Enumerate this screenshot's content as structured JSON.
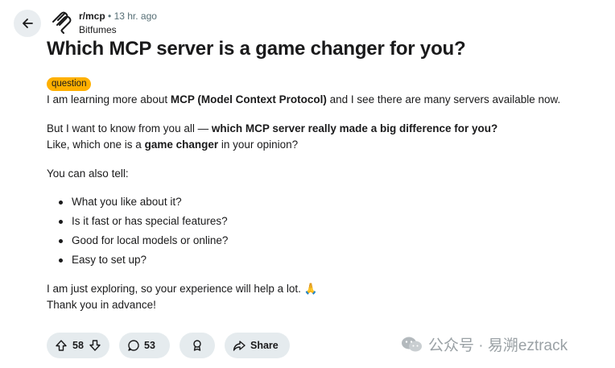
{
  "post": {
    "subreddit": "r/mcp",
    "separator": "•",
    "time_ago": "13 hr. ago",
    "author": "Bitfumes",
    "title": "Which MCP server is a game changer for you?",
    "flair": "question"
  },
  "body": {
    "p1_pre": "I am learning more about ",
    "p1_bold": "MCP (Model Context Protocol)",
    "p1_post": " and I see there are many servers available now.",
    "p2_pre": "But I want to know from you all — ",
    "p2_bold": "which MCP server really made a big difference for you?",
    "p2b_pre": "Like, which one is a ",
    "p2b_bold": "game changer",
    "p2b_post": " in your opinion?",
    "p3": "You can also tell:",
    "list": [
      "What you like about it?",
      "Is it fast or has special features?",
      "Good for local models or online?",
      "Easy to set up?"
    ],
    "p4a": "I am just exploring, so your experience will help a lot.",
    "p4_emoji": "🙏",
    "p4b": "Thank you in advance!"
  },
  "actions": {
    "upvotes": "58",
    "comments": "53",
    "share_label": "Share"
  },
  "watermark": {
    "text": "公众号 · 易溯eztrack"
  },
  "colors": {
    "flair_bg": "#ffb000",
    "pill_bg": "#e5ebee",
    "muted": "#576f76"
  }
}
